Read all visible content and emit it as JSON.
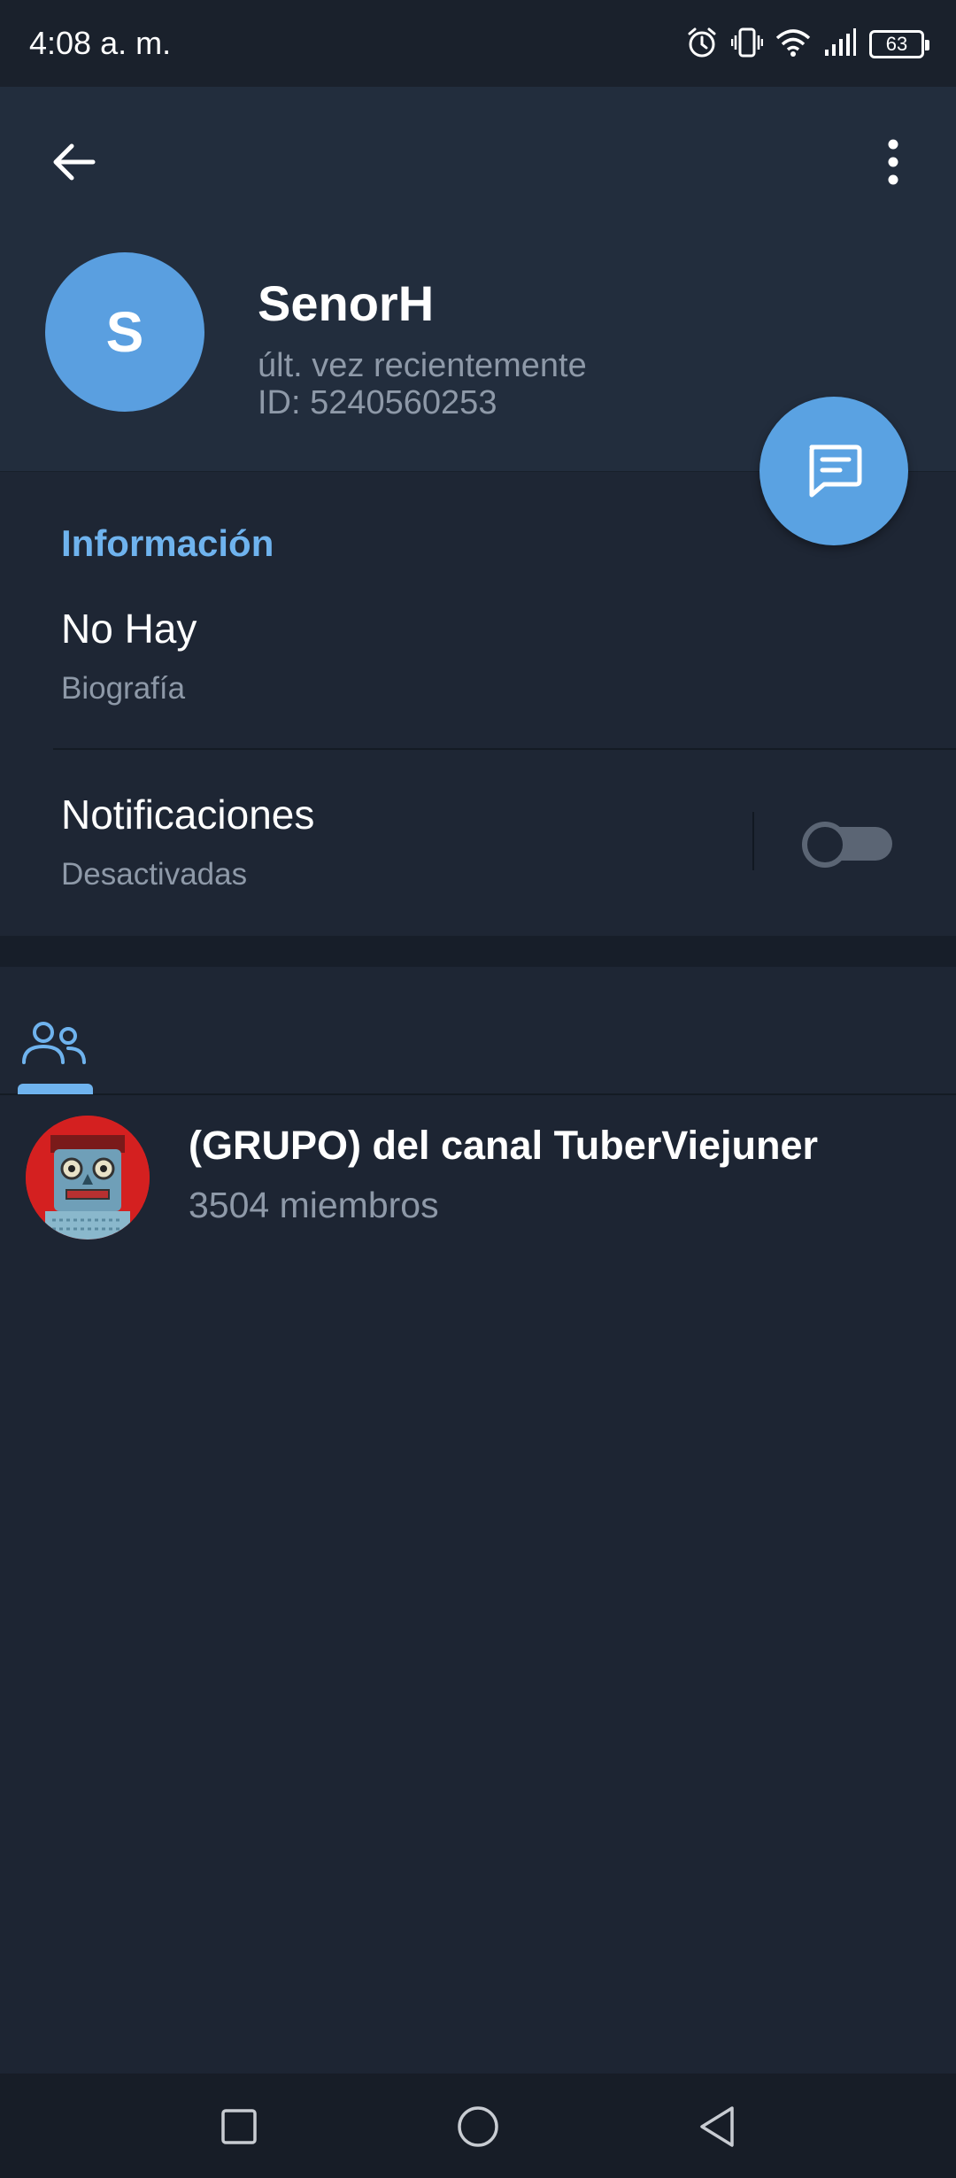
{
  "status_bar": {
    "time": "4:08 a. m.",
    "battery": "63",
    "icons": [
      "alarm-icon",
      "vibrate-icon",
      "wifi-icon",
      "signal-icon",
      "battery-icon"
    ]
  },
  "header": {
    "back_icon": "arrow-left-icon",
    "menu_icon": "more-vertical-icon",
    "avatar_letter": "S",
    "name": "SenorH",
    "last_seen": "últ. vez recientemente",
    "user_id": "ID: 5240560253",
    "message_button_icon": "message-icon"
  },
  "info": {
    "section_title": "Información",
    "bio_value": "No Hay",
    "bio_label": "Biografía",
    "notifications_title": "Notificaciones",
    "notifications_status": "Desactivadas",
    "notifications_enabled": false
  },
  "tabs": [
    {
      "icon": "members-icon",
      "active": true
    }
  ],
  "groups": [
    {
      "name": "(GRUPO) del canal TuberViejuner",
      "members": "3504 miembros"
    }
  ],
  "nav": {
    "icons": [
      "recents-square-icon",
      "home-circle-icon",
      "back-triangle-icon"
    ]
  },
  "colors": {
    "background": "#1d2533",
    "header": "#222d3d",
    "accent": "#6fb3ee",
    "avatar": "#5a9fe0",
    "secondary_text": "#8e99a8"
  }
}
